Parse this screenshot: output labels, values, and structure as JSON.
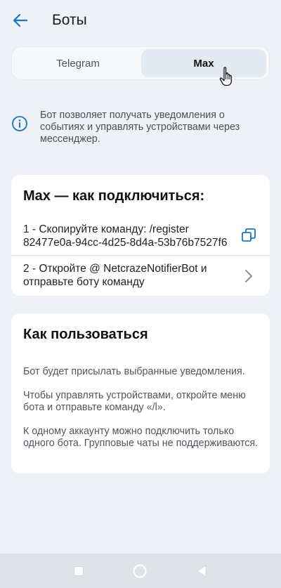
{
  "header": {
    "title": "Боты",
    "back_icon": "arrow-left-icon"
  },
  "tabs": [
    {
      "label": "Telegram",
      "selected": false
    },
    {
      "label": "Max",
      "selected": true
    }
  ],
  "info": {
    "icon": "info-icon",
    "text": "Бот позволяет получать уведомления о событиях и управлять устройствами через мессенджер."
  },
  "connect_card": {
    "title": "Max — как подключиться:",
    "step1": {
      "text": "1 - Скопируйте команду: /register 82477e0a-94cc-4d25-8d4a-53b76b7527f6",
      "icon": "copy-icon"
    },
    "step2": {
      "text": "2 - Откройте @ NetcrazeNotifierBot и отправьте боту команду",
      "icon": "chevron-right-icon"
    }
  },
  "usage_card": {
    "title": "Как пользоваться",
    "paragraphs": [
      "Бот будет присылать выбранные уведомления.",
      "Чтобы управлять устройствами, откройте меню бота и отправьте команду «/l».",
      "К одному аккаунту можно подключить только одного бота. Групповые чаты не поддерживаются."
    ]
  },
  "colors": {
    "accent": "#1a73c7",
    "background": "#eef1f5",
    "card": "#ffffff",
    "tab_selected": "#e3e9f0"
  }
}
